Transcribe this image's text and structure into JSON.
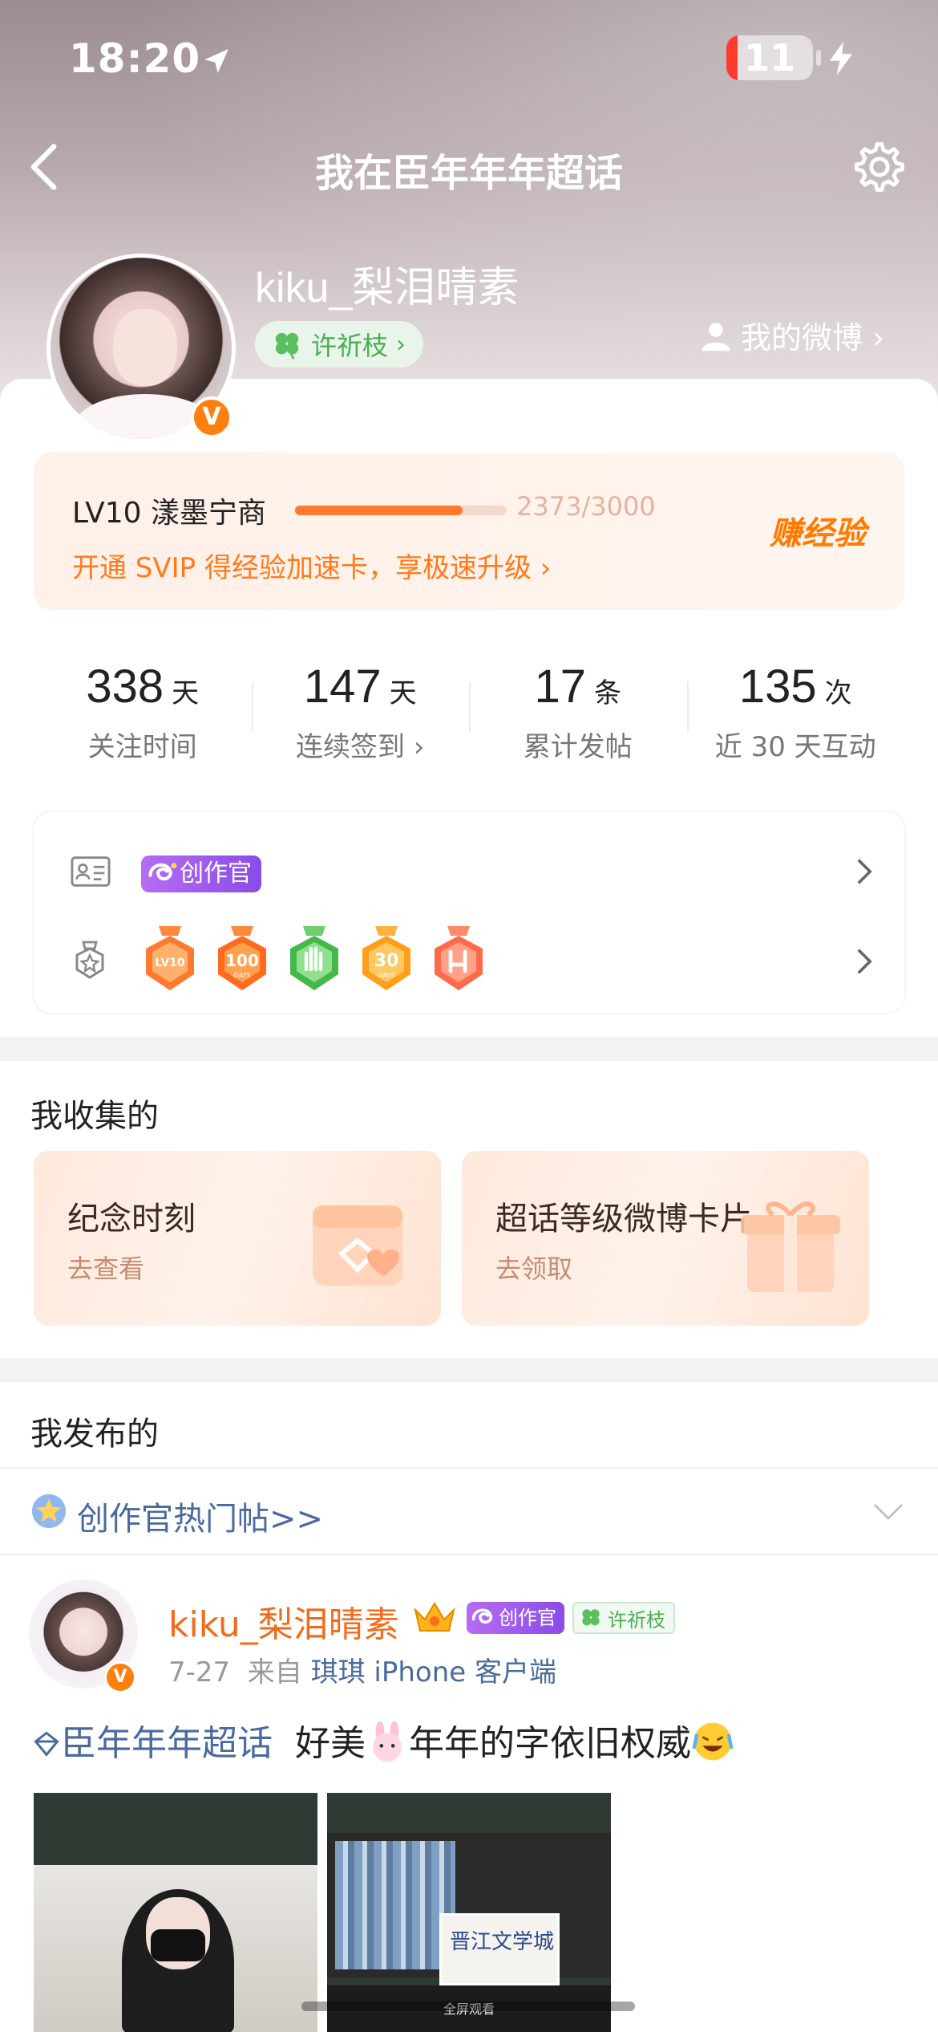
{
  "status_bar": {
    "time": "18:20",
    "battery": "11"
  },
  "nav": {
    "title": "我在臣年年年超话"
  },
  "profile": {
    "username": "kiku_梨泪晴素",
    "title_badge": "许祈枝",
    "title_chevron": "›",
    "my_weibo": "我的微博 ›",
    "verified": "V"
  },
  "level": {
    "name": "LV10 漾墨宁商",
    "progress_text": "2373/3000",
    "progress_fraction": 0.791,
    "svip_text": "开通 SVIP 得经验加速卡，享极速升级 ›",
    "earn_exp": "赚经验"
  },
  "stats": [
    {
      "num": "338",
      "unit": "天",
      "label": "关注时间"
    },
    {
      "num": "147",
      "unit": "天",
      "label": "连续签到 ›"
    },
    {
      "num": "17",
      "unit": "条",
      "label": "累计发帖"
    },
    {
      "num": "135",
      "unit": "次",
      "label": "近 30 天互动"
    }
  ],
  "badges": {
    "creator_label": "创作官",
    "medals": [
      "lv10-medal",
      "100-days-medal",
      "hand-medal",
      "30-days-medal",
      "rock-hand-medal"
    ],
    "medal_texts": {
      "lv": "LV10",
      "hundred": "100",
      "thirty": "30",
      "days": "DAYS"
    }
  },
  "collected": {
    "title": "我收集的",
    "cards": [
      {
        "title": "纪念时刻",
        "sub": "去查看"
      },
      {
        "title": "超话等级微博卡片",
        "sub": "去领取"
      }
    ]
  },
  "published": {
    "title": "我发布的",
    "hot_label": "创作官热门帖>>",
    "post": {
      "user": "kiku_梨泪晴素",
      "creator_badge": "创作官",
      "title_badge": "许祈枝",
      "date": "7-27",
      "from_prefix": "来自",
      "source": "琪琪 iPhone 客户端",
      "topic": "臣年年年超话",
      "text_a": "好美",
      "text_b": "年年的字依旧权威",
      "thumb2_sign": "晋江文学城",
      "thumb2_bar": "全屏观看"
    }
  },
  "colors": {
    "accent": "#ff7a1a",
    "link": "#4a6a9e",
    "green": "#4aae54",
    "purple": "#9a55ee"
  }
}
